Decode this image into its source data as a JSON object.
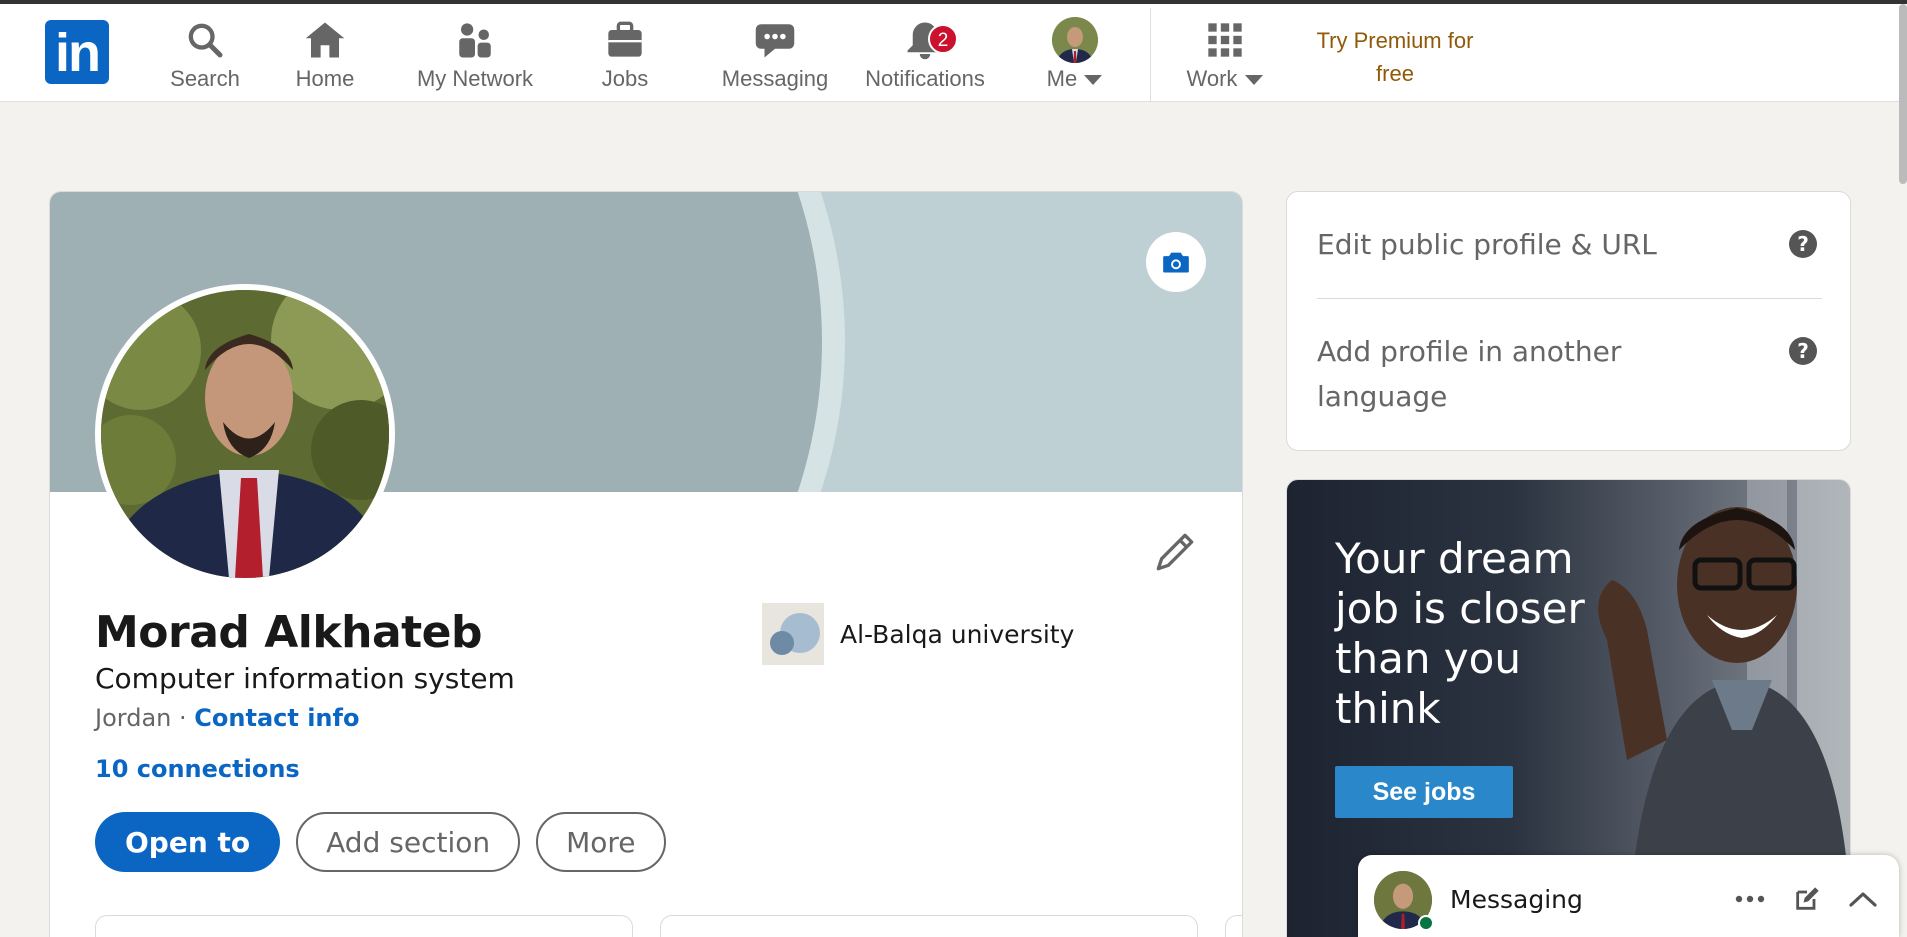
{
  "nav": {
    "logo_text": "in",
    "items": [
      {
        "label": "Search",
        "icon": "search-icon"
      },
      {
        "label": "Home",
        "icon": "home-icon"
      },
      {
        "label": "My Network",
        "icon": "network-icon"
      },
      {
        "label": "Jobs",
        "icon": "briefcase-icon"
      },
      {
        "label": "Messaging",
        "icon": "chat-icon"
      },
      {
        "label": "Notifications",
        "icon": "bell-icon",
        "badge": "2"
      },
      {
        "label": "Me",
        "icon": "avatar"
      },
      {
        "label": "Work",
        "icon": "grid-icon"
      }
    ],
    "premium": "Try Premium for free"
  },
  "profile": {
    "name": "Morad Alkhateb",
    "headline": "Computer information system",
    "location": "Jordan",
    "separator": "·",
    "contact_link": "Contact info",
    "connections": "10 connections",
    "education": "Al-Balqa university",
    "buttons": {
      "open_to": "Open to",
      "add_section": "Add section",
      "more": "More"
    }
  },
  "sidebar": {
    "items": [
      {
        "label": "Edit public profile & URL",
        "help": "?"
      },
      {
        "label": "Add profile in another language",
        "help": "?"
      }
    ]
  },
  "ad": {
    "text": "Your dream job is closer than you think",
    "button": "See jobs"
  },
  "messaging": {
    "title": "Messaging"
  },
  "colors": {
    "brand": "#0a66c2",
    "premium": "#915907",
    "badge": "#cb112d"
  }
}
